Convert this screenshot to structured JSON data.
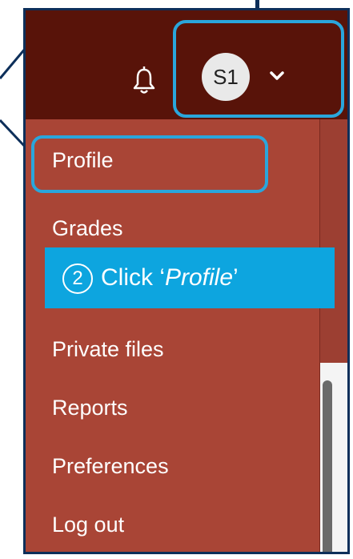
{
  "header": {
    "avatar_initials": "S1"
  },
  "menu": {
    "items": [
      {
        "label": "Profile",
        "highlighted": true
      },
      {
        "label": "Grades"
      },
      {
        "label": "Private files"
      },
      {
        "label": "Reports"
      },
      {
        "label": "Preferences"
      },
      {
        "label": "Log out"
      }
    ]
  },
  "callout": {
    "step_number": "2",
    "prefix": "Click ‘",
    "target": "Profile",
    "suffix": "’"
  },
  "icons": {
    "notifications": "bell-icon",
    "user_menu_toggle": "chevron-down-icon"
  },
  "colors": {
    "topbar": "#581309",
    "menu_bg": "#a94536",
    "highlight": "#2aa6dc",
    "callout_bg": "#0da5df"
  }
}
